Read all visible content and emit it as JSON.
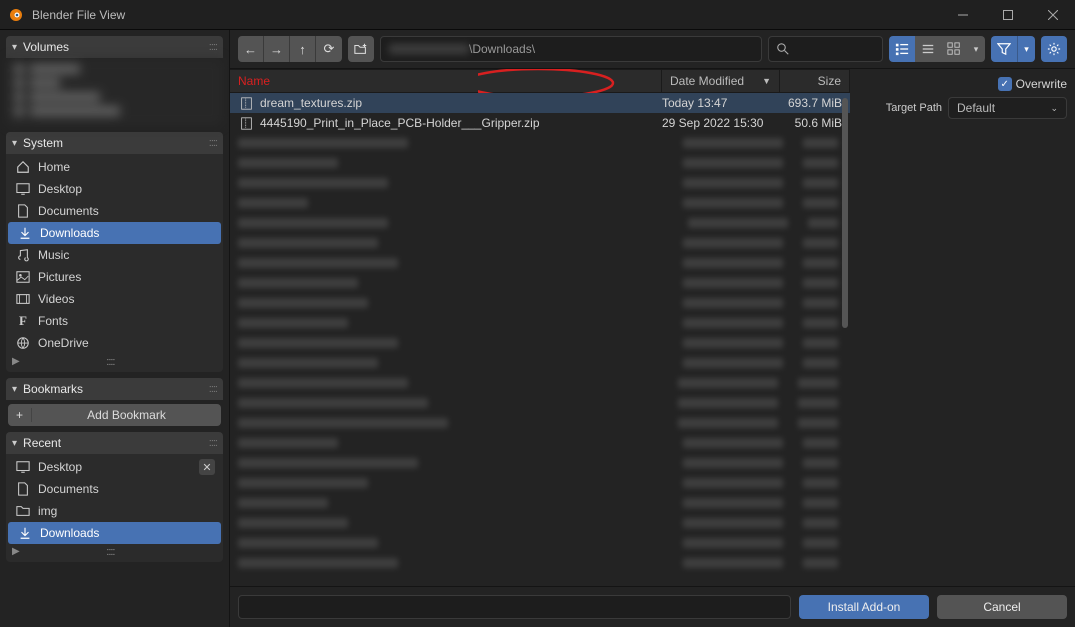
{
  "window": {
    "title": "Blender File View"
  },
  "sidebar": {
    "volumes": {
      "title": "Volumes"
    },
    "system": {
      "title": "System",
      "items": [
        {
          "label": "Home"
        },
        {
          "label": "Desktop"
        },
        {
          "label": "Documents"
        },
        {
          "label": "Downloads",
          "selected": true
        },
        {
          "label": "Music"
        },
        {
          "label": "Pictures"
        },
        {
          "label": "Videos"
        },
        {
          "label": "Fonts"
        },
        {
          "label": "OneDrive"
        }
      ]
    },
    "bookmarks": {
      "title": "Bookmarks",
      "add_label": "Add Bookmark"
    },
    "recent": {
      "title": "Recent",
      "items": [
        {
          "label": "Desktop",
          "closable": true
        },
        {
          "label": "Documents"
        },
        {
          "label": "img"
        },
        {
          "label": "Downloads",
          "selected": true
        }
      ]
    }
  },
  "toolbar": {
    "path": "\\Downloads\\"
  },
  "columns": {
    "name": "Name",
    "date": "Date Modified",
    "size": "Size"
  },
  "files": [
    {
      "name": "dream_textures.zip",
      "date": "Today 13:47",
      "size": "693.7 MiB",
      "highlighted": true
    },
    {
      "name": "4445190_Print_in_Place_PCB-Holder___Gripper.zip",
      "date": "29 Sep 2022 15:30",
      "size": "50.6 MiB"
    }
  ],
  "options": {
    "overwrite": {
      "label": "Overwrite",
      "checked": true
    },
    "target_path": {
      "label": "Target Path",
      "value": "Default"
    }
  },
  "actions": {
    "install": "Install Add-on",
    "cancel": "Cancel"
  }
}
